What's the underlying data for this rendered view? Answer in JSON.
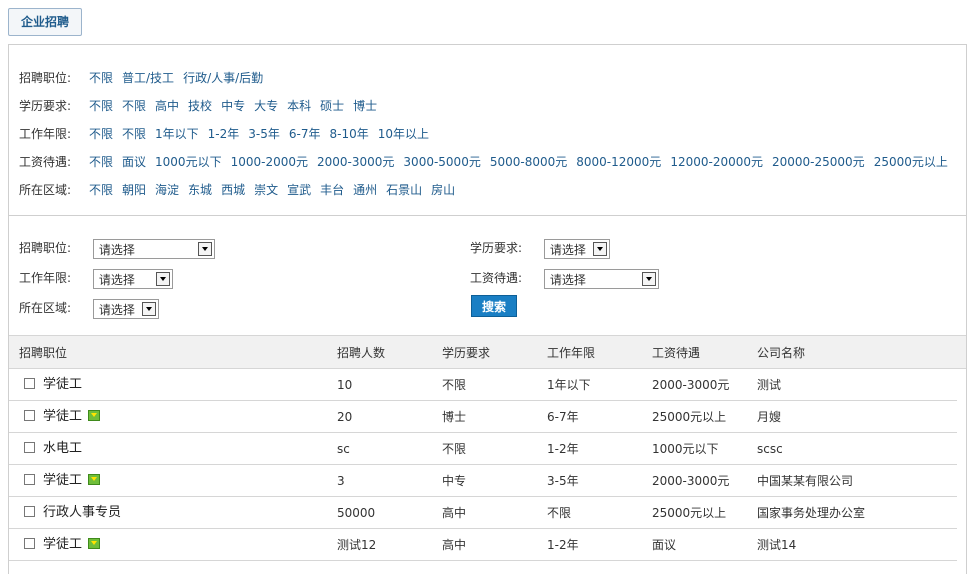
{
  "tab": {
    "label": "企业招聘"
  },
  "filters": [
    {
      "label": "招聘职位:",
      "options": [
        "不限",
        "普工/技工",
        "行政/人事/后勤"
      ]
    },
    {
      "label": "学历要求:",
      "options": [
        "不限",
        "不限",
        "高中",
        "技校",
        "中专",
        "大专",
        "本科",
        "硕士",
        "博士"
      ]
    },
    {
      "label": "工作年限:",
      "options": [
        "不限",
        "不限",
        "1年以下",
        "1-2年",
        "3-5年",
        "6-7年",
        "8-10年",
        "10年以上"
      ]
    },
    {
      "label": "工资待遇:",
      "options": [
        "不限",
        "面议",
        "1000元以下",
        "1000-2000元",
        "2000-3000元",
        "3000-5000元",
        "5000-8000元",
        "8000-12000元",
        "12000-20000元",
        "20000-25000元",
        "25000元以上"
      ]
    },
    {
      "label": "所在区域:",
      "options": [
        "不限",
        "朝阳",
        "海淀",
        "东城",
        "西城",
        "崇文",
        "宣武",
        "丰台",
        "通州",
        "石景山",
        "房山"
      ]
    }
  ],
  "search": {
    "position_label": "招聘职位:",
    "education_label": "学历要求:",
    "experience_label": "工作年限:",
    "salary_label": "工资待遇:",
    "area_label": "所在区域:",
    "select_value": "请选择",
    "button_label": "搜索"
  },
  "table": {
    "headers": [
      "招聘职位",
      "招聘人数",
      "学历要求",
      "工作年限",
      "工资待遇",
      "公司名称"
    ],
    "rows": [
      {
        "title": "学徒工",
        "hot": false,
        "count": "10",
        "education": "不限",
        "experience": "1年以下",
        "salary": "2000-3000元",
        "company": "测试"
      },
      {
        "title": "学徒工",
        "hot": true,
        "count": "20",
        "education": "博士",
        "experience": "6-7年",
        "salary": "25000元以上",
        "company": "月嫂"
      },
      {
        "title": "水电工",
        "hot": false,
        "count": "sc",
        "education": "不限",
        "experience": "1-2年",
        "salary": "1000元以下",
        "company": "scsc"
      },
      {
        "title": "学徒工",
        "hot": true,
        "count": "3",
        "education": "中专",
        "experience": "3-5年",
        "salary": "2000-3000元",
        "company": "中国某某有限公司"
      },
      {
        "title": "行政人事专员",
        "hot": false,
        "count": "50000",
        "education": "高中",
        "experience": "不限",
        "salary": "25000元以上",
        "company": "国家事务处理办公室"
      },
      {
        "title": "学徒工",
        "hot": true,
        "count": "测试12",
        "education": "高中",
        "experience": "1-2年",
        "salary": "面议",
        "company": "测试14"
      }
    ]
  }
}
